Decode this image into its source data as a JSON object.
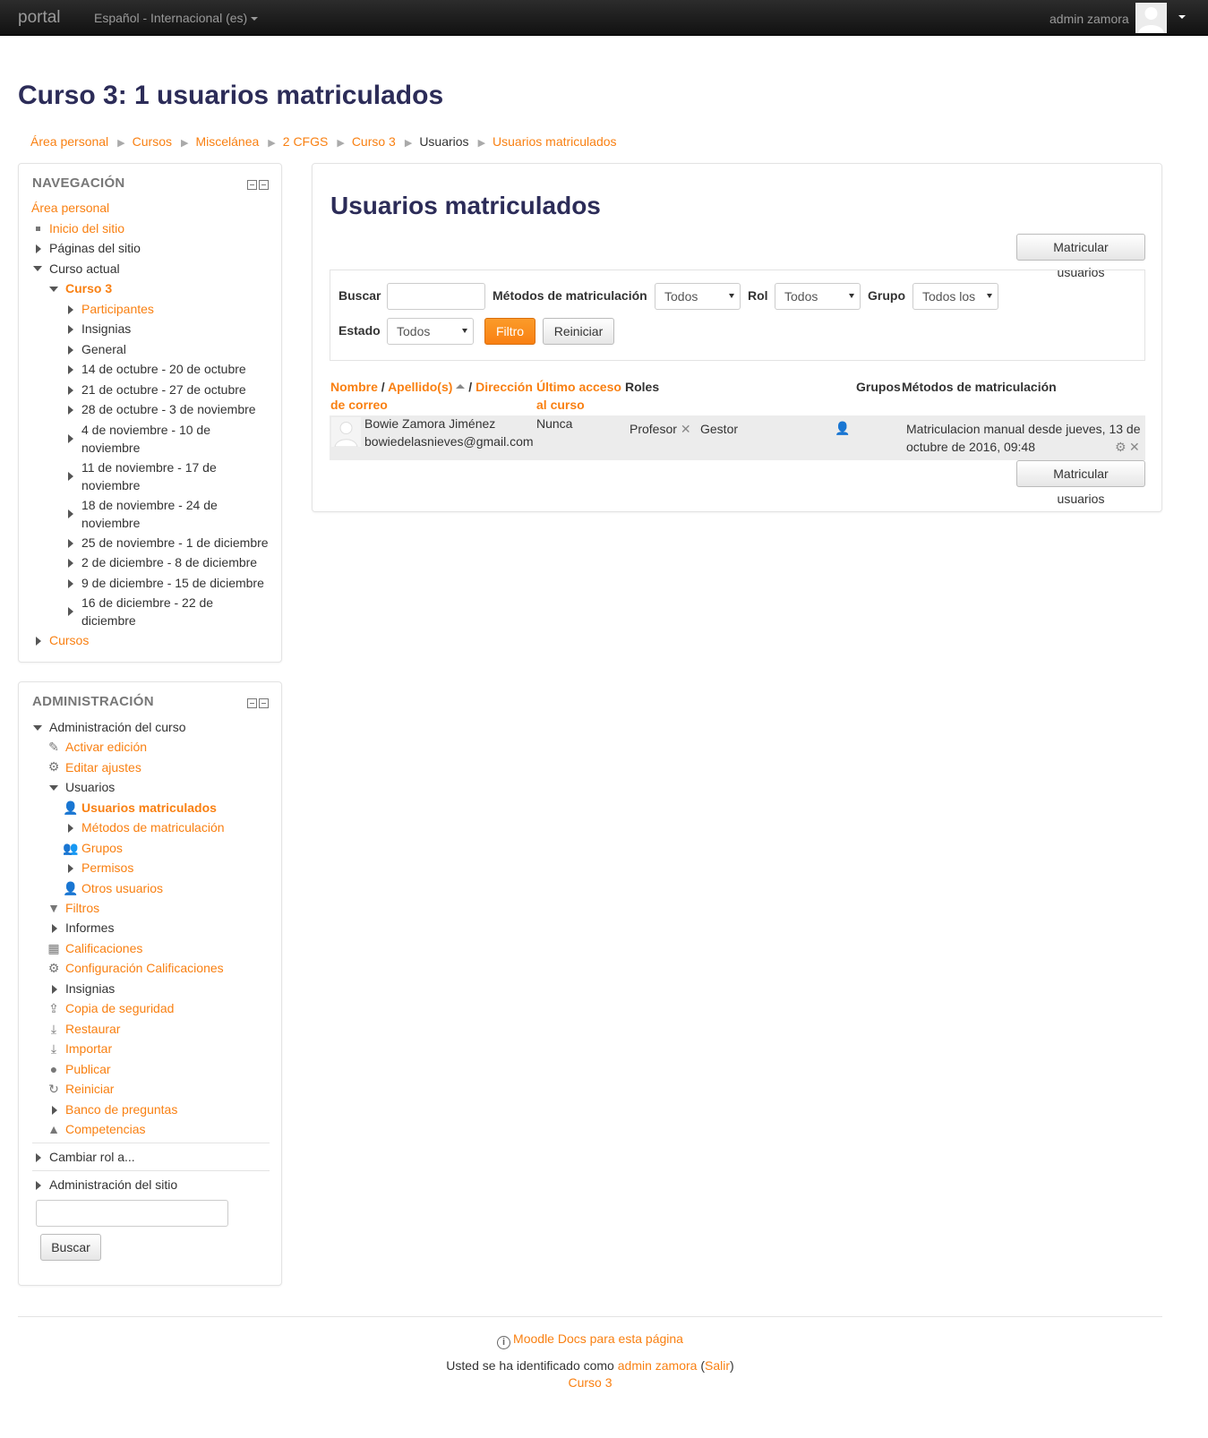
{
  "navbar": {
    "brand": "portal",
    "language": "Español - Internacional (es)",
    "user_name": "admin zamora"
  },
  "page": {
    "title": "Curso 3: 1 usuarios matriculados"
  },
  "breadcrumb": [
    "Área personal",
    "Cursos",
    "Miscelánea",
    "2 CFGS",
    "Curso 3",
    "Usuarios",
    "Usuarios matriculados"
  ],
  "navigation": {
    "title": "NAVEGACIÓN",
    "area_personal": "Área personal",
    "inicio": "Inicio del sitio",
    "paginas": "Páginas del sitio",
    "curso_actual": "Curso actual",
    "curso3": "Curso 3",
    "participantes": "Participantes",
    "insignias": "Insignias",
    "general": "General",
    "weeks": [
      "14 de octubre - 20 de octubre",
      "21 de octubre - 27 de octubre",
      "28 de octubre - 3 de noviembre",
      "4 de noviembre - 10 de noviembre",
      "11 de noviembre - 17 de noviembre",
      "18 de noviembre - 24 de noviembre",
      "25 de noviembre - 1 de diciembre",
      "2 de diciembre - 8 de diciembre",
      "9 de diciembre - 15 de diciembre",
      "16 de diciembre - 22 de diciembre"
    ],
    "cursos": "Cursos"
  },
  "administration": {
    "title": "ADMINISTRACIÓN",
    "admin_curso": "Administración del curso",
    "activar": "Activar edición",
    "editar": "Editar ajustes",
    "usuarios": "Usuarios",
    "matriculados": "Usuarios matriculados",
    "metodos": "Métodos de matriculación",
    "grupos": "Grupos",
    "permisos": "Permisos",
    "otros": "Otros usuarios",
    "filtros": "Filtros",
    "informes": "Informes",
    "calificaciones": "Calificaciones",
    "config_calif": "Configuración Calificaciones",
    "insignias": "Insignias",
    "copia": "Copia de seguridad",
    "restaurar": "Restaurar",
    "importar": "Importar",
    "publicar": "Publicar",
    "reiniciar": "Reiniciar",
    "banco": "Banco de preguntas",
    "competencias": "Competencias",
    "cambiar_rol": "Cambiar rol a...",
    "admin_sitio": "Administración del sitio",
    "search_value": "",
    "search_button": "Buscar"
  },
  "main": {
    "heading": "Usuarios matriculados",
    "enrol_button": "Matricular usuarios",
    "filter": {
      "buscar_label": "Buscar",
      "buscar_value": "",
      "metodos_label": "Métodos de matriculación",
      "metodos_value": "Todos",
      "rol_label": "Rol",
      "rol_value": "Todos",
      "grupo_label": "Grupo",
      "grupo_value": "Todos los",
      "estado_label": "Estado",
      "estado_value": "Todos",
      "filtro_button": "Filtro",
      "reiniciar_button": "Reiniciar"
    },
    "table": {
      "h_nombre": "Nombre",
      "h_sep1": " / ",
      "h_apellido": "Apellido(s)",
      "h_sep2": " / ",
      "h_email_1": "Dirección",
      "h_email_2": "de correo",
      "h_acceso_1": "Último acceso",
      "h_acceso_2": "al curso",
      "h_roles": "Roles",
      "h_grupos": "Grupos",
      "h_metodos": "Métodos de matriculación",
      "rows": [
        {
          "name": "Bowie Zamora Jiménez",
          "email": "bowiedelasnieves@gmail.com",
          "last_access": "Nunca",
          "role1": "Profesor",
          "role2": "Gestor",
          "method_1": "Matriculacion manual desde jueves, 13 de",
          "method_2": "octubre de 2016, 09:48"
        }
      ]
    }
  },
  "footer": {
    "docs": "Moodle Docs para esta página",
    "logged_prefix": "Usted se ha identificado como ",
    "logged_user": "admin zamora",
    "logout_open": " (",
    "logout": "Salir",
    "logout_close": ")",
    "course": "Curso 3"
  },
  "colors": {
    "accent": "#f98012",
    "heading": "#2c2c58",
    "navbar": "#1a1a1a"
  }
}
